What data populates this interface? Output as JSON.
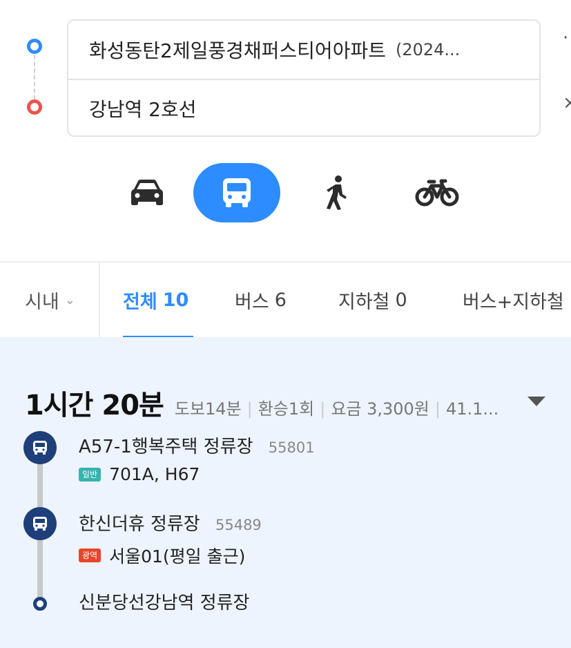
{
  "route": {
    "origin": "화성동탄2제일풍경채퍼스티어아파트",
    "origin_suffix": "(2024...",
    "destination": "강남역 2호선"
  },
  "modes": [
    {
      "name": "car",
      "icon": "car-icon",
      "active": false
    },
    {
      "name": "transit",
      "icon": "bus-icon",
      "active": true
    },
    {
      "name": "walk",
      "icon": "walk-icon",
      "active": false
    },
    {
      "name": "bike",
      "icon": "bicycle-icon",
      "active": false
    }
  ],
  "filters": {
    "city_label": "시내",
    "tabs": [
      {
        "label": "전체",
        "count": "10",
        "active": true
      },
      {
        "label": "버스",
        "count": "6",
        "active": false
      },
      {
        "label": "지하철",
        "count": "0",
        "active": false
      },
      {
        "label": "버스+지하철",
        "count": "",
        "active": false
      }
    ]
  },
  "result": {
    "duration": "1시간 20분",
    "walk": "도보14분",
    "transfers": "환승1회",
    "fare": "요금 3,300원",
    "distance": "41.1...",
    "stops": [
      {
        "name": "A57-1행복주택 정류장",
        "code": "55801",
        "badge": "일반",
        "lines": "701A, H67"
      },
      {
        "name": "한신더휴 정류장",
        "code": "55489",
        "badge": "광역",
        "lines": "서울01(평일 출근)"
      },
      {
        "name": "신분당선강남역 정류장",
        "code": "",
        "badge": "",
        "lines": ""
      }
    ]
  },
  "colors": {
    "accent": "#2d8cff",
    "origin": "#2d8cff",
    "destination": "#f0514a",
    "stop_icon": "#1f3f7a",
    "badge_general": "#33b5ad",
    "badge_wide": "#e8452c",
    "result_bg": "#edf4fd"
  }
}
